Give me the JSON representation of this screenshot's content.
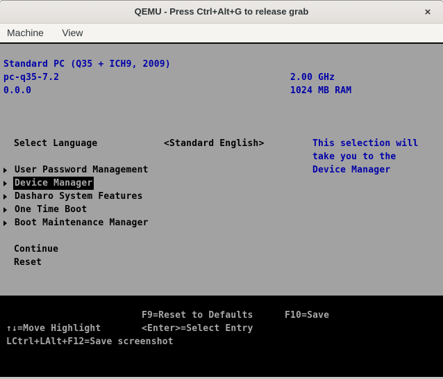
{
  "window": {
    "title": "QEMU - Press Ctrl+Alt+G to release grab",
    "close_label": "×",
    "menus": [
      {
        "label": "Machine"
      },
      {
        "label": "View"
      }
    ]
  },
  "firmware": {
    "colors": {
      "screen_background": "#a2a2a2",
      "text_blue": "#0000a8",
      "text_black": "#000000",
      "highlight_background": "#000000",
      "highlight_text": "#a8a8a8",
      "footer_background": "#000000",
      "footer_text": "#a8a8a8"
    },
    "header": {
      "platform": "Standard PC (Q35 + ICH9, 2009)",
      "version": "pc-q35-7.2",
      "build": "0.0.0",
      "cpu": "2.00 GHz",
      "ram": "1024 MB RAM"
    },
    "language": {
      "label": "Select Language",
      "value": "<Standard English>"
    },
    "help_text": [
      "This selection will",
      "take you to the",
      "Device Manager"
    ],
    "menu_items": [
      {
        "label": "User Password Management",
        "selected": false
      },
      {
        "label": "Device Manager",
        "selected": true
      },
      {
        "label": "Dasharo System Features",
        "selected": false
      },
      {
        "label": "One Time Boot",
        "selected": false
      },
      {
        "label": "Boot Maintenance Manager",
        "selected": false
      }
    ],
    "actions": [
      {
        "label": "Continue"
      },
      {
        "label": "Reset"
      }
    ],
    "footer": {
      "reset_hint": "F9=Reset to Defaults",
      "save_hint": "F10=Save",
      "move_hint": "↑↓=Move Highlight",
      "select_hint": "<Enter>=Select Entry",
      "screenshot_hint": "LCtrl+LAlt+F12=Save screenshot"
    }
  }
}
